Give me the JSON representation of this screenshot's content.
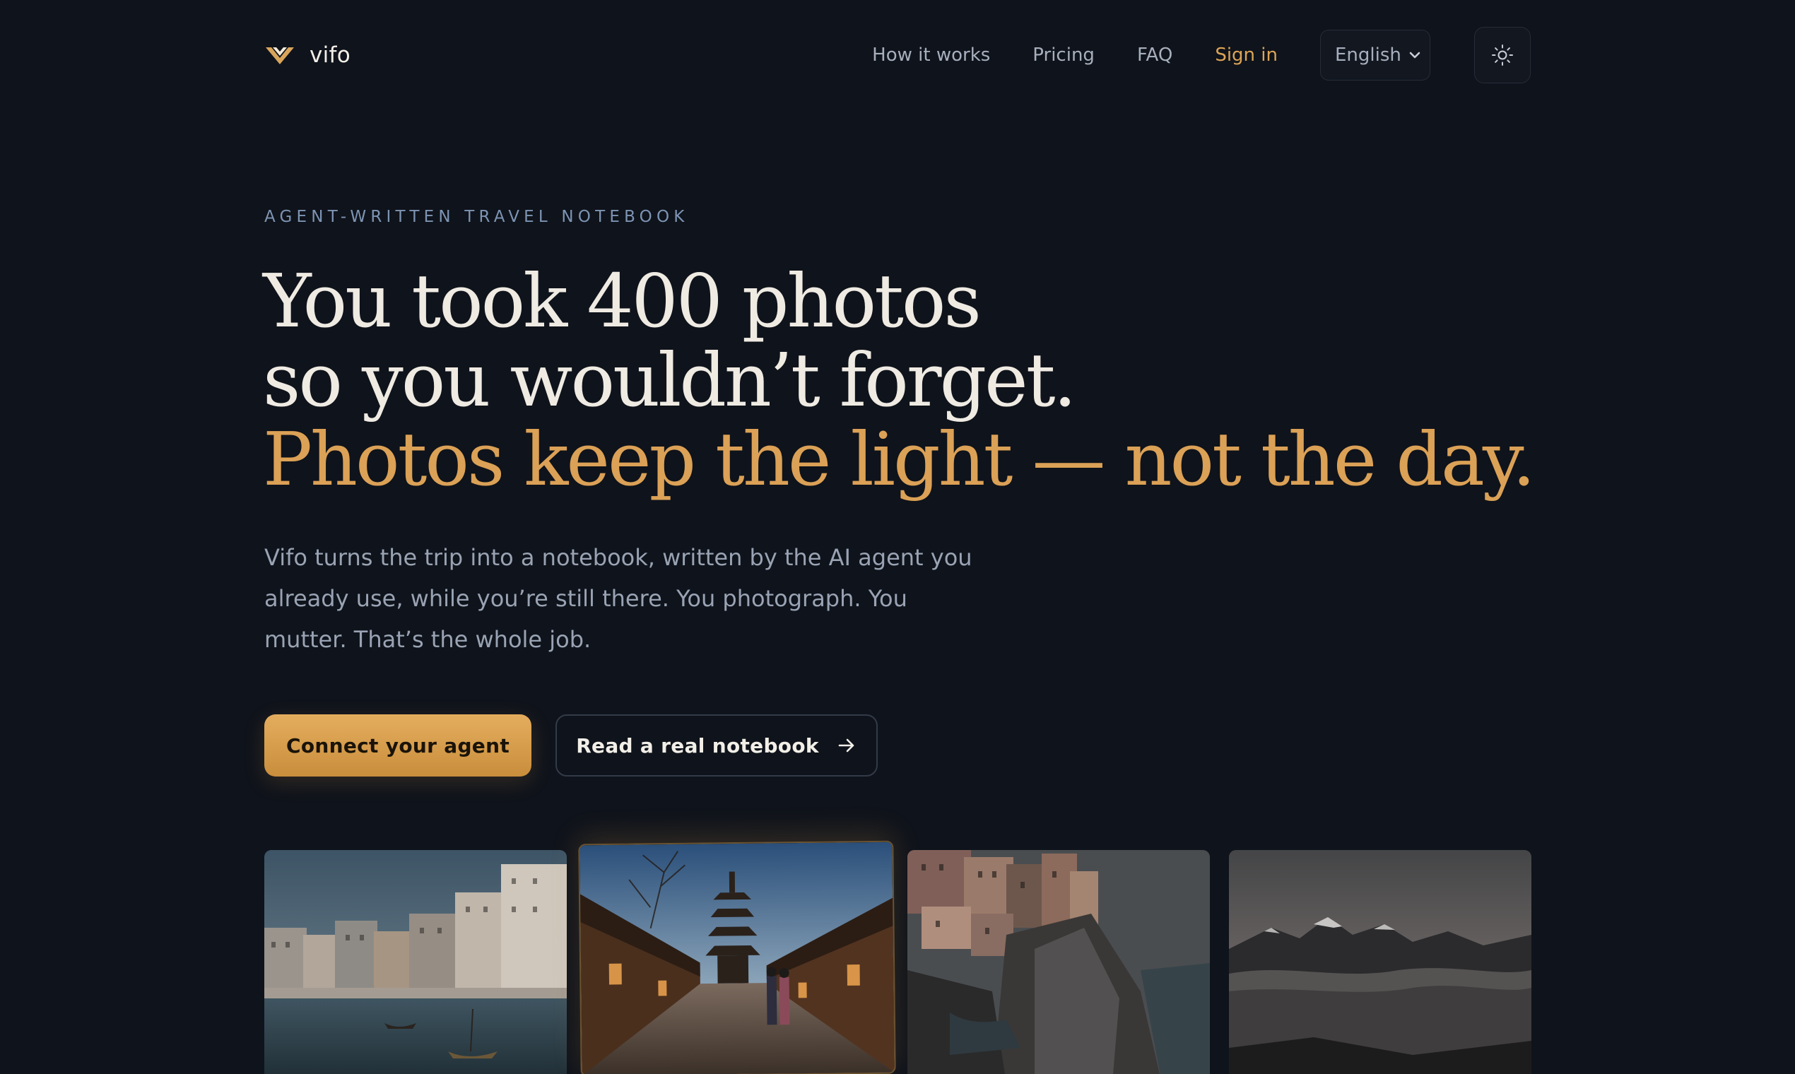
{
  "brand": {
    "name": "vifo",
    "logo_icon": "chevron-v-logo-icon",
    "logo_color": "#d9a55a"
  },
  "nav": {
    "links": [
      {
        "label": "How it works"
      },
      {
        "label": "Pricing"
      },
      {
        "label": "FAQ"
      },
      {
        "label": "Sign in"
      }
    ],
    "language": {
      "selected": "English"
    },
    "theme_toggle_icon": "sun-icon"
  },
  "hero": {
    "eyebrow": "AGENT-WRITTEN TRAVEL NOTEBOOK",
    "headline_line1": "You took 400 photos",
    "headline_line2": "so you wouldn’t forget.",
    "headline_accent": "Photos keep the light — not the day.",
    "lede": "Vifo turns the trip into a notebook, written by the AI agent you already use, while you’re still there. You photograph. You mutter. That’s the whole job.",
    "cta_primary": "Connect your agent",
    "cta_secondary": "Read a real notebook",
    "cta_secondary_icon": "arrow-right-icon"
  },
  "photos": [
    {
      "alt": "harbor-town"
    },
    {
      "alt": "pagoda-street"
    },
    {
      "alt": "cliff-village"
    },
    {
      "alt": "mountain-clouds"
    }
  ],
  "colors": {
    "background": "#0f131b",
    "accent": "#dba156",
    "text": "#efebe3",
    "muted": "#99a3b3",
    "eyebrow": "#7d94b3"
  }
}
